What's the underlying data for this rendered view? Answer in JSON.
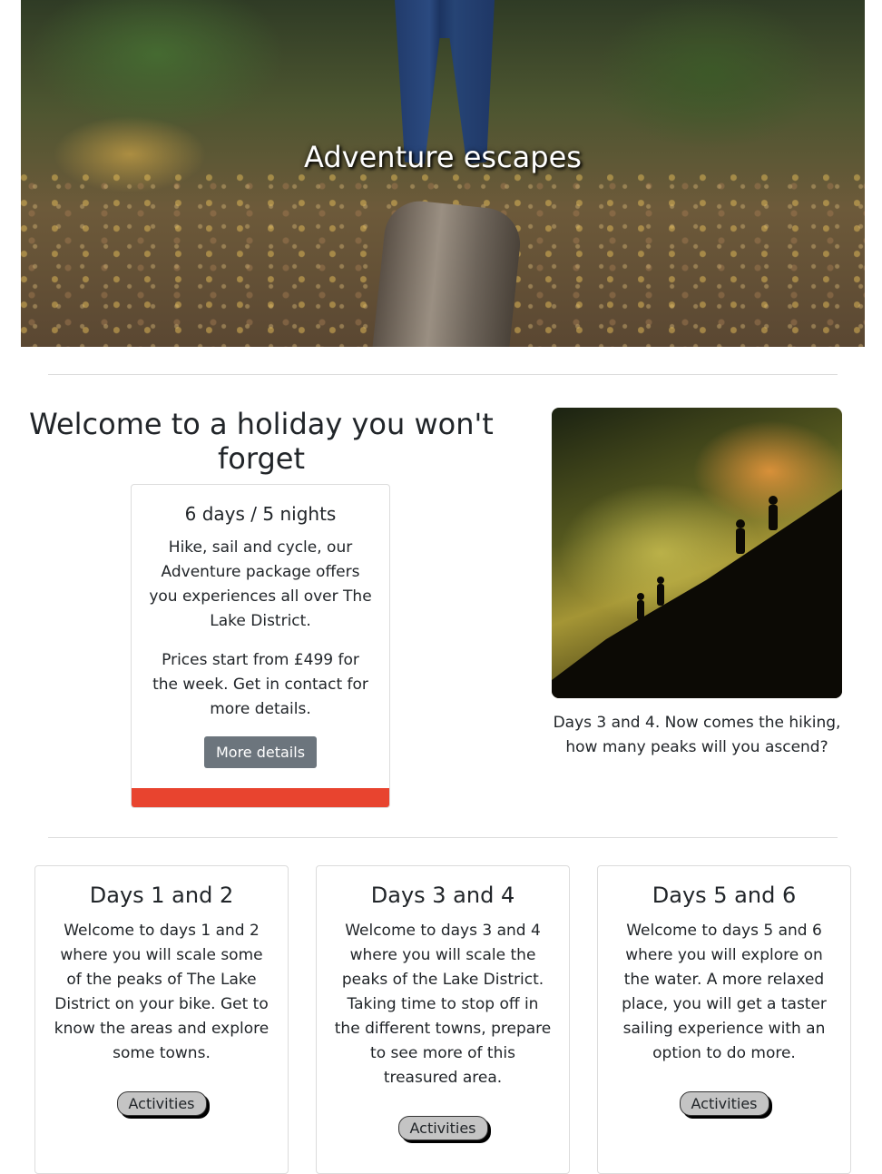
{
  "hero": {
    "title": "Adventure escapes"
  },
  "welcome": {
    "heading": "Welcome to a holiday you won't forget",
    "card": {
      "title": "6 days / 5 nights",
      "description": "Hike, sail and cycle, our Adventure package offers you experiences all over The Lake District.",
      "price_text": "Prices start from £499 for the week. Get in contact for more details.",
      "button_label": "More details",
      "accent_color": "#e8442f"
    }
  },
  "feature_image": {
    "caption": "Days 3 and 4. Now comes the hiking, how many peaks will you ascend?"
  },
  "days": [
    {
      "title": "Days 1 and 2",
      "text": "Welcome to days 1 and 2 where you will scale some of the peaks of The Lake District on your bike. Get to know the areas and explore some towns.",
      "button_label": "Activities"
    },
    {
      "title": "Days 3 and 4",
      "text": "Welcome to days 3 and 4 where you will scale the peaks of the Lake District. Taking time to stop off in the different towns, prepare to see more of this treasured area.",
      "button_label": "Activities"
    },
    {
      "title": "Days 5 and 6",
      "text": "Welcome to days 5 and 6 where you will explore on the water. A more relaxed place, you will get a taster sailing experience with an option to do more.",
      "button_label": "Activities"
    }
  ]
}
